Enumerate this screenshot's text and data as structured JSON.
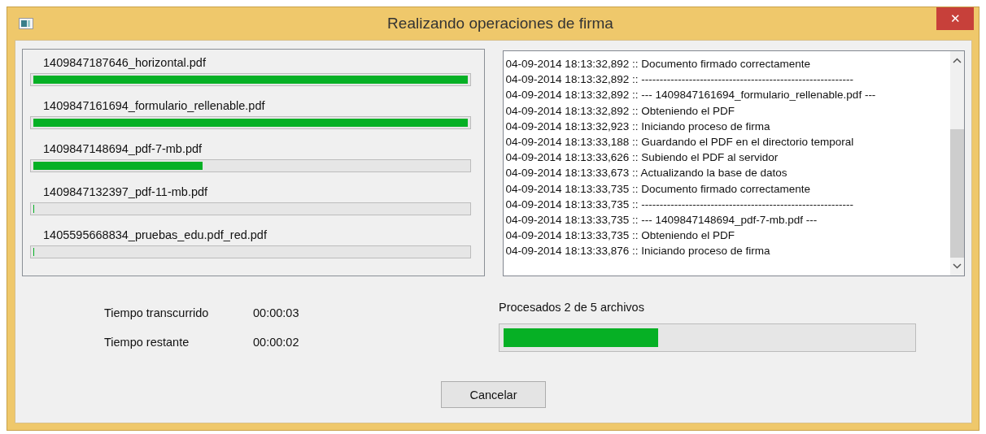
{
  "window": {
    "title": "Realizando operaciones de firma",
    "close": "✕"
  },
  "files": [
    {
      "name": "1409847187646_horizontal.pdf",
      "level": 1
    },
    {
      "name": "1409847161694_formulario_rellenable.pdf",
      "level": 1
    },
    {
      "name": "1409847148694_pdf-7-mb.pdf",
      "level": 0.39
    },
    {
      "name": "1409847132397_pdf-11-mb.pdf",
      "level": 0
    },
    {
      "name": "1405595668834_pruebas_edu.pdf_red.pdf",
      "level": 0
    }
  ],
  "log": [
    "04-09-2014 18:13:32,892 :: Documento firmado correctamente",
    "04-09-2014 18:13:32,892 :: ----------------------------------------------------------",
    "04-09-2014 18:13:32,892 :: --- 1409847161694_formulario_rellenable.pdf ---",
    "04-09-2014 18:13:32,892 :: Obteniendo el PDF",
    "04-09-2014 18:13:32,923 :: Iniciando proceso de firma",
    "04-09-2014 18:13:33,188 :: Guardando el PDF en el directorio temporal",
    "04-09-2014 18:13:33,626 :: Subiendo el PDF al servidor",
    "04-09-2014 18:13:33,673 :: Actualizando la base de datos",
    "04-09-2014 18:13:33,735 :: Documento firmado correctamente",
    "04-09-2014 18:13:33,735 :: ----------------------------------------------------------",
    "04-09-2014 18:13:33,735 :: --- 1409847148694_pdf-7-mb.pdf ---",
    "04-09-2014 18:13:33,735 :: Obteniendo el PDF",
    "04-09-2014 18:13:33,876 :: Iniciando proceso de firma"
  ],
  "times": [
    {
      "label": "Tiempo transcurrido",
      "value": "00:00:03"
    },
    {
      "label": "Tiempo restante",
      "value": "00:00:02"
    }
  ],
  "overall": {
    "label": "Procesados 2 de 5 archivos",
    "level": 0.38
  },
  "buttons": [
    "Cancelar"
  ]
}
